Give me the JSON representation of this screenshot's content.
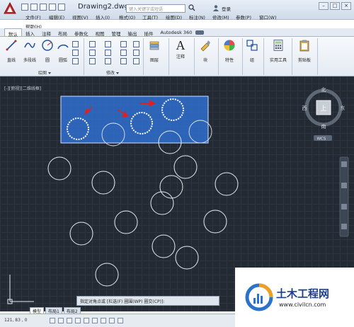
{
  "window": {
    "document_title": "Drawing2.dwg",
    "search_placeholder": "键入关键字或短语",
    "login_label": "登录"
  },
  "menu": {
    "items": [
      "文件(F)",
      "编辑(E)",
      "视图(V)",
      "插入(I)",
      "格式(O)",
      "工具(T)",
      "绘图(D)",
      "标注(N)",
      "修改(M)",
      "参数(P)",
      "窗口(W)"
    ],
    "help": "帮助(H)"
  },
  "ribbon_tabs": [
    "默认",
    "插入",
    "注释",
    "布局",
    "参数化",
    "视图",
    "管理",
    "输出",
    "插件",
    "Autodesk 360"
  ],
  "ribbon": {
    "draw_tools": [
      "直线",
      "多段线",
      "圆",
      "圆弧"
    ],
    "draw_panel": "绘图",
    "modify_panel": "修改",
    "layers": "图层",
    "annotation": "注释",
    "annotation_glyph": "A",
    "block": "块",
    "properties": "特性",
    "group": "组",
    "utilities": "实用工具",
    "clipboard": "剪贴板"
  },
  "canvas": {
    "viewport_label": "[-][俯视][二维线框]",
    "viewcube_top": "上",
    "compass_n": "北",
    "compass_s": "南",
    "compass_e": "东",
    "compass_w": "西",
    "wcs_label": "WCS"
  },
  "command_line": "指定对角点或 [栏选(F) 圈围(WP) 圈交(CP)]:",
  "layout_tabs": [
    "模型",
    "布局1",
    "布局2"
  ],
  "status": {
    "coords": "121, 83 , 0"
  },
  "watermark": {
    "name": "土木工程网",
    "url": "www.civilcn.com"
  },
  "colors": {
    "canvas_bg": "#232a34",
    "selection_fill": "#2f6fd0",
    "arrow_red": "#e02020",
    "title_bar": "#dbe5f1"
  }
}
